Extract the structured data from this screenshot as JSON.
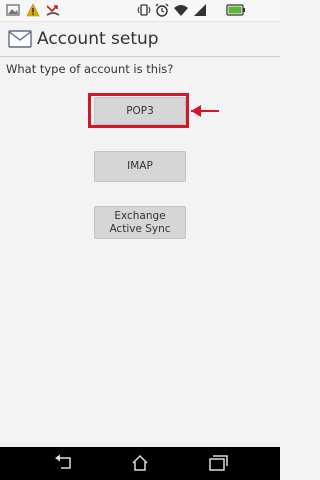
{
  "header": {
    "title": "Account setup",
    "icon": "email-icon"
  },
  "prompt": "What type of account is this?",
  "account_types": [
    {
      "label": "POP3",
      "highlighted": true
    },
    {
      "label": "IMAP"
    },
    {
      "label": "Exchange Active Sync"
    }
  ],
  "annotation": {
    "color": "#d3162a"
  },
  "statusbar": {
    "left_icons": [
      "image-notification-icon",
      "warning-icon",
      "missed-call-icon"
    ],
    "right_icons": [
      "vibrate-icon",
      "alarm-icon",
      "wifi-icon",
      "signal-icon",
      "battery-icon"
    ]
  },
  "navbar": {
    "icons": [
      "back-icon",
      "home-icon",
      "recent-apps-icon"
    ]
  }
}
